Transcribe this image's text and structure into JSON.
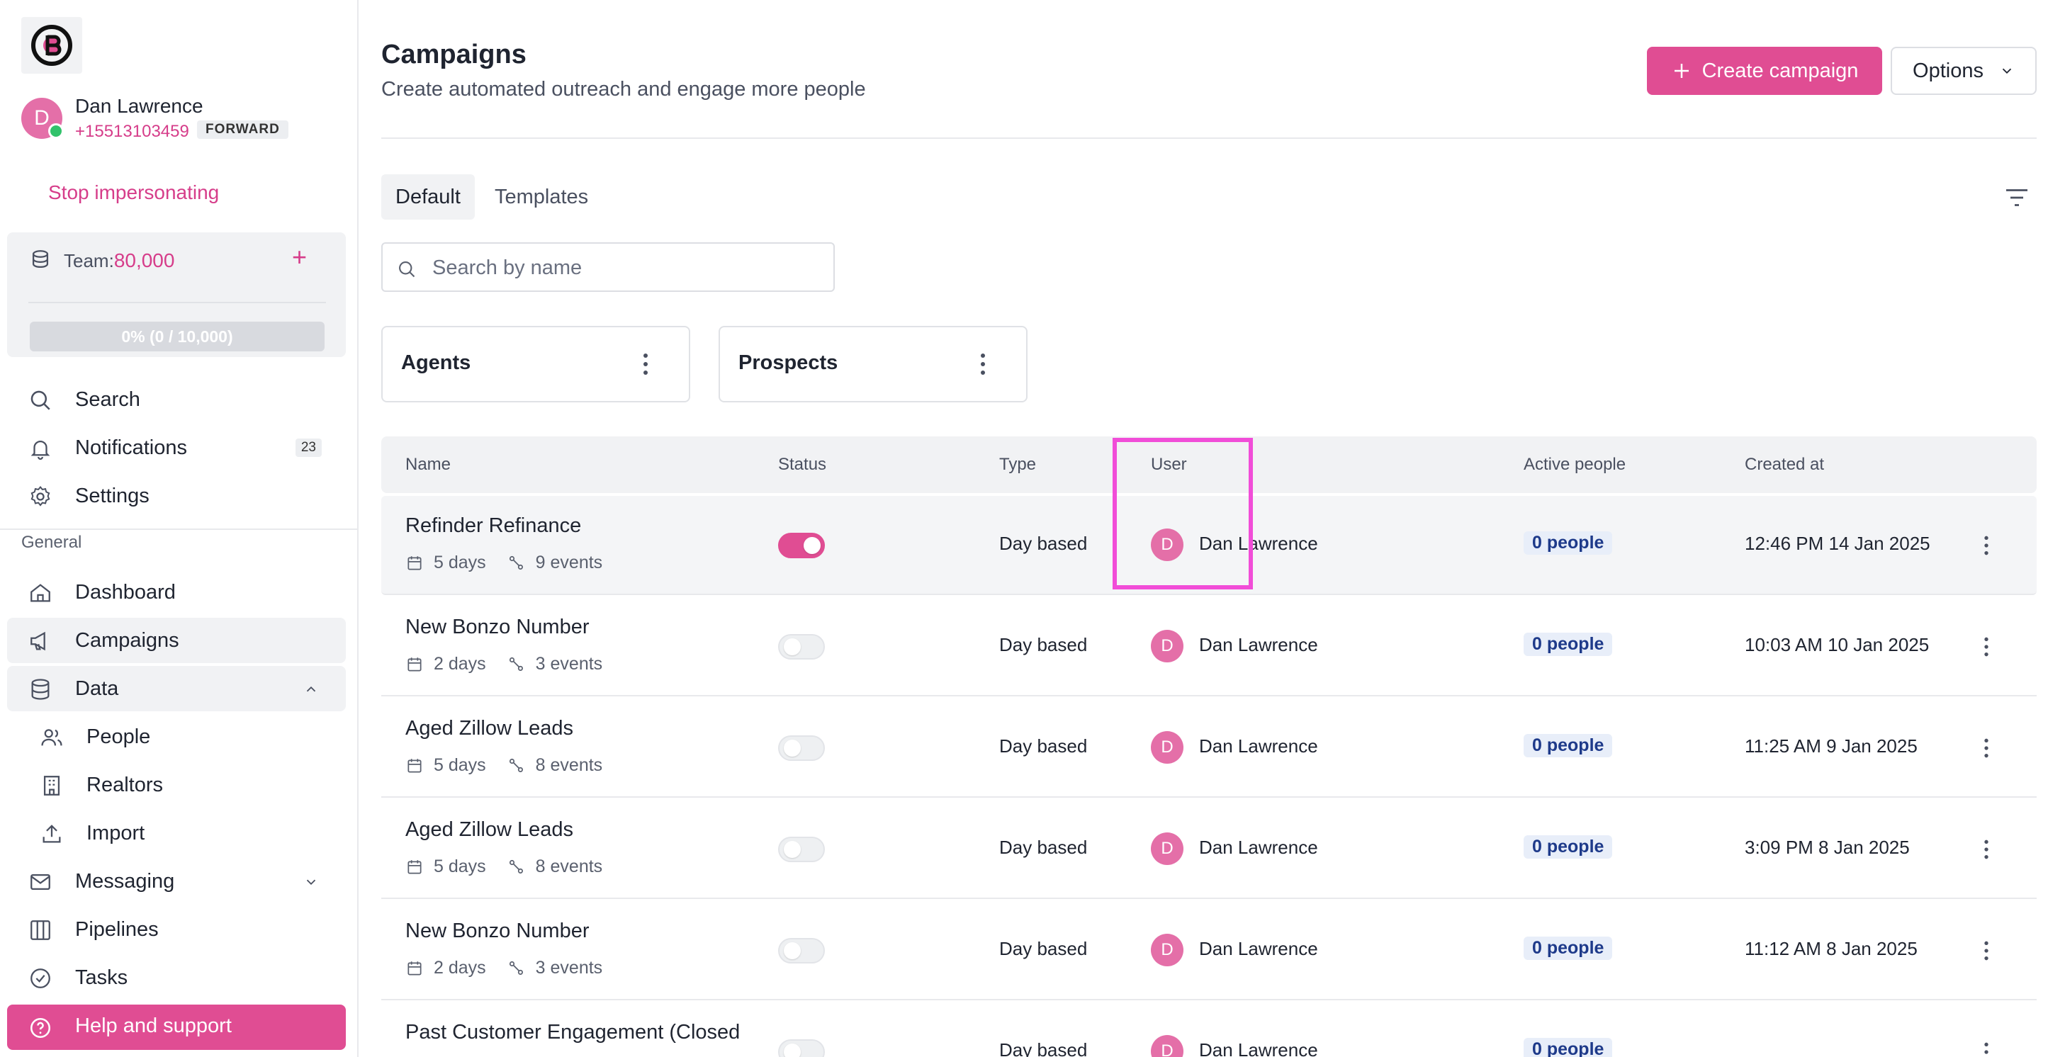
{
  "sidebar": {
    "profile": {
      "initial": "D",
      "name": "Dan Lawrence",
      "phone": "+15513103459",
      "badge": "FORWARD"
    },
    "stop_impersonating": "Stop impersonating",
    "team": {
      "label": "Team:",
      "value": "80,000",
      "usage": "0% (0 / 10,000)",
      "usage_fraction": 0
    },
    "top_items": [
      {
        "label": "Search",
        "icon": "search-icon"
      },
      {
        "label": "Notifications",
        "icon": "bell-icon",
        "count": "23"
      },
      {
        "label": "Settings",
        "icon": "gear-icon"
      }
    ],
    "section_label": "General",
    "items": [
      {
        "label": "Dashboard",
        "icon": "home-icon"
      },
      {
        "label": "Campaigns",
        "icon": "megaphone-icon",
        "active": true
      },
      {
        "label": "Data",
        "icon": "database-icon",
        "expanded": true
      },
      {
        "label": "People",
        "icon": "people-icon",
        "sub": true
      },
      {
        "label": "Realtors",
        "icon": "building-icon",
        "sub": true
      },
      {
        "label": "Import",
        "icon": "upload-icon",
        "sub": true
      },
      {
        "label": "Messaging",
        "icon": "mail-icon",
        "collapsed": true
      },
      {
        "label": "Pipelines",
        "icon": "columns-icon"
      },
      {
        "label": "Tasks",
        "icon": "check-circle-icon"
      }
    ],
    "help": "Help and support"
  },
  "header": {
    "title": "Campaigns",
    "subtitle": "Create automated outreach and engage more people",
    "create_label": "Create campaign",
    "options_label": "Options"
  },
  "tabs": [
    {
      "label": "Default",
      "active": true
    },
    {
      "label": "Templates",
      "active": false
    }
  ],
  "search": {
    "placeholder": "Search by name",
    "value": ""
  },
  "folders": [
    {
      "name": "Agents"
    },
    {
      "name": "Prospects"
    }
  ],
  "table": {
    "columns": {
      "name": "Name",
      "status": "Status",
      "type": "Type",
      "user": "User",
      "active_people": "Active people",
      "created_at": "Created at"
    },
    "rows": [
      {
        "name": "Refinder Refinance",
        "days": "5 days",
        "events": "9 events",
        "status": true,
        "type": "Day based",
        "user_initial": "D",
        "user": "Dan Lawrence",
        "people": "0 people",
        "created": "12:46 PM 14 Jan 2025"
      },
      {
        "name": "New Bonzo Number",
        "days": "2 days",
        "events": "3 events",
        "status": false,
        "type": "Day based",
        "user_initial": "D",
        "user": "Dan Lawrence",
        "people": "0 people",
        "created": "10:03 AM 10 Jan 2025"
      },
      {
        "name": "Aged Zillow Leads",
        "days": "5 days",
        "events": "8 events",
        "status": false,
        "type": "Day based",
        "user_initial": "D",
        "user": "Dan Lawrence",
        "people": "0 people",
        "created": "11:25 AM 9 Jan 2025"
      },
      {
        "name": "Aged Zillow Leads",
        "days": "5 days",
        "events": "8 events",
        "status": false,
        "type": "Day based",
        "user_initial": "D",
        "user": "Dan Lawrence",
        "people": "0 people",
        "created": "3:09 PM 8 Jan 2025"
      },
      {
        "name": "New Bonzo Number",
        "days": "2 days",
        "events": "3 events",
        "status": false,
        "type": "Day based",
        "user_initial": "D",
        "user": "Dan Lawrence",
        "people": "0 people",
        "created": "11:12 AM 8 Jan 2025"
      },
      {
        "name": "Past Customer Engagement (Closed",
        "days": "",
        "events": "",
        "status": false,
        "type": "Day based",
        "user_initial": "D",
        "user": "Dan Lawrence",
        "people": "0 people",
        "created": ""
      }
    ]
  },
  "colors": {
    "accent": "#e04d93",
    "highlight_box": "#f14dd8",
    "people_badge_text": "#1e3a8a"
  }
}
